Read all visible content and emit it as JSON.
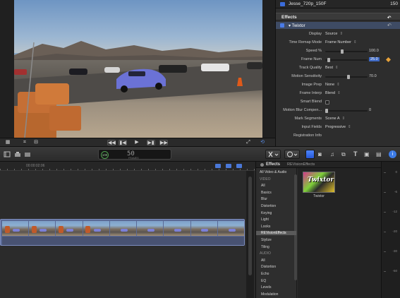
{
  "inspector": {
    "clip_name": "Jesse_720p_150F",
    "clip_number": "150",
    "section_title": "Effects",
    "effect_title": "Twixtor",
    "params": [
      {
        "label": "Display",
        "value": "Source"
      },
      {
        "label": "Time Remap Mode",
        "value": "Frame Number"
      },
      {
        "label": "Speed %",
        "slider": 0.4,
        "value": "100.0"
      },
      {
        "label": "Frame Num",
        "slider": 0.05,
        "value": "25.0",
        "highlight": true
      },
      {
        "label": "Track Quality",
        "value": "Best"
      },
      {
        "label": "Motion Sensitivity",
        "slider": 0.55,
        "value": "70.0"
      },
      {
        "label": "Image Prep",
        "value": "None"
      },
      {
        "label": "Frame Interp",
        "value": "Blend"
      },
      {
        "label": "Smart Blend",
        "value": ""
      },
      {
        "label": "Motion Blur Compen...",
        "slider": 0.0,
        "value": "0"
      },
      {
        "label": "Mark Segments",
        "value": "Scene A"
      },
      {
        "label": "Input Fields",
        "value": "Progressive"
      },
      {
        "label": "Registration Info",
        "value": ""
      }
    ]
  },
  "dashboard": {
    "percent": "100",
    "fps": "50",
    "fps_unit": "FRAMES"
  },
  "timeline": {
    "timecode": "00:00:02:06"
  },
  "effects_browser": {
    "title": "Effects",
    "subtitle": "REVisionEffects",
    "categories": [
      {
        "label": "All Video & Audio",
        "kind": "top"
      },
      {
        "label": "VIDEO",
        "kind": "section"
      },
      {
        "label": "All",
        "kind": "item"
      },
      {
        "label": "Basics",
        "kind": "item"
      },
      {
        "label": "Blur",
        "kind": "item"
      },
      {
        "label": "Distortion",
        "kind": "item"
      },
      {
        "label": "Keying",
        "kind": "item"
      },
      {
        "label": "Light",
        "kind": "item"
      },
      {
        "label": "Looks",
        "kind": "item"
      },
      {
        "label": "REVisionEffects",
        "kind": "selected"
      },
      {
        "label": "Stylize",
        "kind": "item"
      },
      {
        "label": "Tiling",
        "kind": "item"
      },
      {
        "label": "AUDIO",
        "kind": "section"
      },
      {
        "label": "All",
        "kind": "item"
      },
      {
        "label": "Distortion",
        "kind": "item"
      },
      {
        "label": "Echo",
        "kind": "item"
      },
      {
        "label": "EQ",
        "kind": "item"
      },
      {
        "label": "Levels",
        "kind": "item"
      },
      {
        "label": "Modulation",
        "kind": "item"
      }
    ],
    "effect_name": "Twixtor",
    "effect_logo": "Twixtor"
  },
  "meters": {
    "ticks": [
      "0",
      "-6",
      "-12",
      "-20",
      "-30",
      "-50"
    ]
  },
  "colors": {
    "accent_blue": "#3d68c4",
    "keyframe_orange": "#e8a23a"
  }
}
